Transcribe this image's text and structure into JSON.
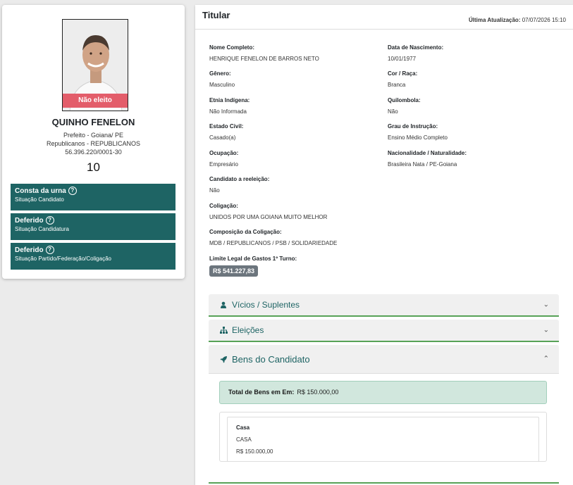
{
  "candidate": {
    "status_ribbon": "Não eleito",
    "name": "QUINHO FENELON",
    "office": "Prefeito - Goiana/ PE",
    "party": "Republicanos - REPUBLICANOS",
    "cnpj": "56.396.220/0001-30",
    "number": "10"
  },
  "status_boxes": [
    {
      "title": "Consta da urna",
      "subtitle": "Situação Candidato"
    },
    {
      "title": "Deferido",
      "subtitle": "Situação Candidatura"
    },
    {
      "title": "Deferido",
      "subtitle": "Situação Partido/Federação/Coligação"
    }
  ],
  "header": {
    "title": "Titular",
    "last_update_label": "Última Atualização:",
    "last_update_value": "07/07/2026 15:10"
  },
  "fields": {
    "nome": {
      "label": "Nome Completo:",
      "value": "HENRIQUE FENELON DE BARROS NETO"
    },
    "nascimento": {
      "label": "Data de Nascimento:",
      "value": "10/01/1977"
    },
    "genero": {
      "label": "Gênero:",
      "value": "Masculino"
    },
    "cor": {
      "label": "Cor / Raça:",
      "value": "Branca"
    },
    "etnia": {
      "label": "Etnia Indígena:",
      "value": "Não Informada"
    },
    "quilombola": {
      "label": "Quilombola:",
      "value": "Não"
    },
    "estado_civil": {
      "label": "Estado Civil:",
      "value": "Casado(a)"
    },
    "instrucao": {
      "label": "Grau de Instrução:",
      "value": "Ensino Médio Completo"
    },
    "ocupacao": {
      "label": "Ocupação:",
      "value": "Empresário"
    },
    "nacionalidade": {
      "label": "Nacionalidade / Naturalidade:",
      "value": "Brasileira Nata / PE-Goiana"
    },
    "reeleicao": {
      "label": "Candidato a reeleição:",
      "value": "Não"
    },
    "coligacao": {
      "label": "Coligação:",
      "value": "UNIDOS POR UMA GOIANA MUITO MELHOR"
    },
    "composicao": {
      "label": "Composição da Coligação:",
      "value": "MDB / REPUBLICANOS / PSB / SOLIDARIEDADE"
    },
    "limite": {
      "label": "Limite Legal de Gastos 1º Turno:",
      "value": "R$ 541.227,83"
    }
  },
  "accordions": {
    "vicios": {
      "label": "Vícios / Suplentes",
      "icon": "user-icon"
    },
    "eleicoes": {
      "label": "Eleições",
      "icon": "sitemap-icon"
    },
    "bens": {
      "label": "Bens do Candidato",
      "icon": "rocket-icon"
    }
  },
  "bens": {
    "total_label": "Total de Bens em Em:",
    "total_value": "R$ 150.000,00",
    "items": [
      {
        "title": "Casa",
        "description": "CASA",
        "value": "R$ 150.000,00"
      }
    ]
  },
  "colors": {
    "teal": "#1e6464",
    "danger": "#e35d6a",
    "success_bg": "#d1e7dd",
    "accent_line": "#57a257"
  }
}
